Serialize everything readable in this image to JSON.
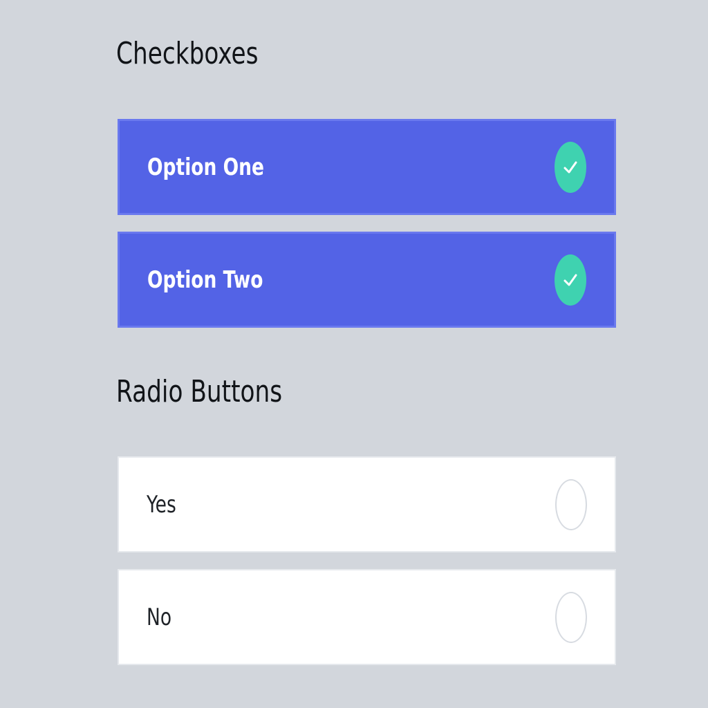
{
  "checkboxes": {
    "title": "Checkboxes",
    "options": [
      {
        "label": "Option One",
        "checked": true
      },
      {
        "label": "Option Two",
        "checked": true
      }
    ]
  },
  "radios": {
    "title": "Radio Buttons",
    "options": [
      {
        "label": "Yes",
        "selected": false
      },
      {
        "label": "No",
        "selected": false
      }
    ]
  },
  "colors": {
    "background": "#d2d6dc",
    "checked_option": "#5363e6",
    "check_indicator": "#3fd2b0",
    "unchecked_option": "#ffffff"
  },
  "icons": {
    "check": "check-icon",
    "radio_empty": "radio-empty-icon"
  }
}
